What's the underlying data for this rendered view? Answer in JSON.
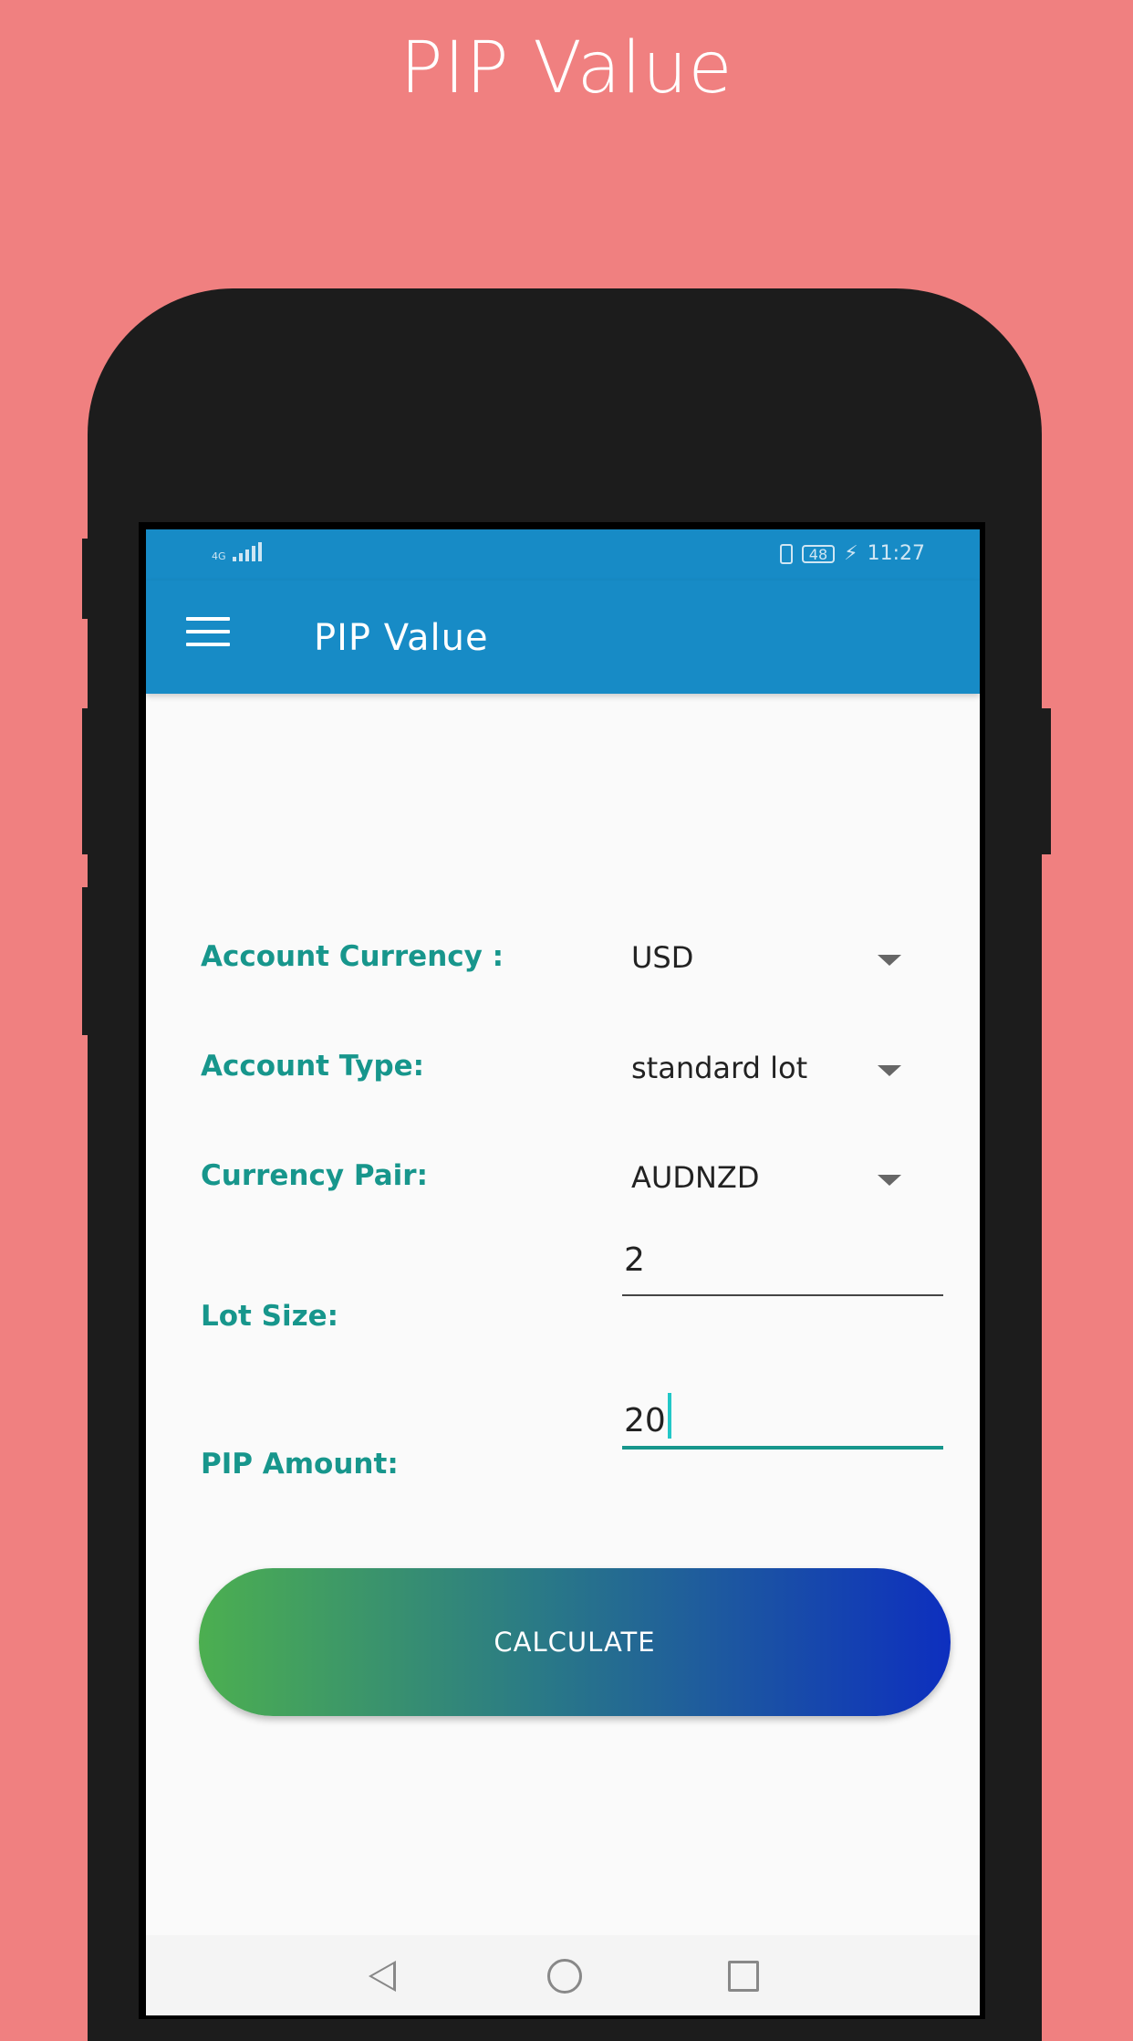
{
  "promo": {
    "title": "PIP Value"
  },
  "status_bar": {
    "network": "4G",
    "battery": "48",
    "time": "11:27"
  },
  "toolbar": {
    "title": "PIP Value",
    "menu_icon": "hamburger-menu-icon"
  },
  "form": {
    "account_currency": {
      "label": "Account Currency :",
      "value": "USD"
    },
    "account_type": {
      "label": "Account Type:",
      "value": "standard lot"
    },
    "currency_pair": {
      "label": "Currency Pair:",
      "value": "AUDNZD"
    },
    "lot_size": {
      "label": "Lot Size:",
      "value": "2"
    },
    "pip_amount": {
      "label": "PIP Amount:",
      "value": "20"
    }
  },
  "calculate_button": {
    "label": "CALCULATE"
  },
  "colors": {
    "background": "#f08080",
    "app_bar": "#178bc6",
    "label_teal": "#17968c",
    "button_gradient_start": "#4caf50",
    "button_gradient_end": "#0d2fbf"
  },
  "nav": {
    "back_icon": "back-triangle-icon",
    "home_icon": "home-circle-icon",
    "recents_icon": "recents-square-icon"
  }
}
